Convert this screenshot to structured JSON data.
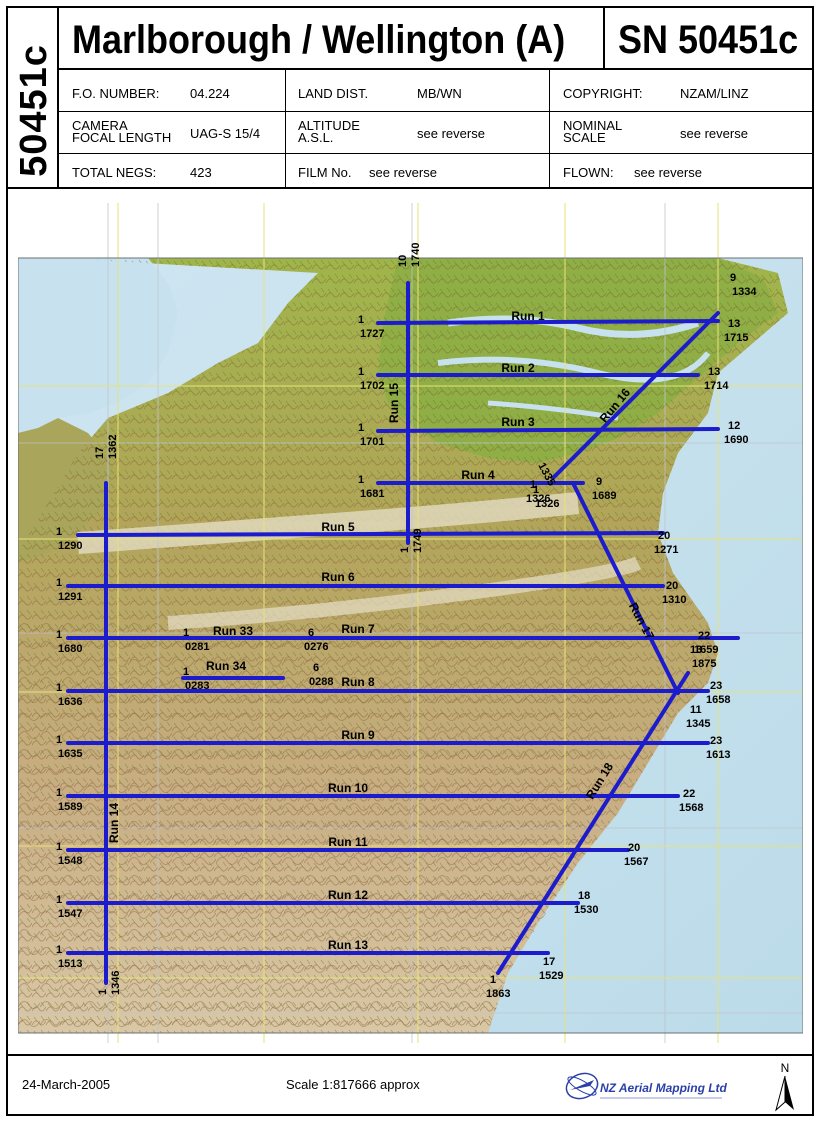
{
  "header": {
    "side_code": "50451c",
    "title": "Marlborough / Wellington (A)",
    "sn_label": "SN  50451c"
  },
  "info": {
    "fo_label": "F.O. NUMBER:",
    "fo_value": "04.224",
    "land_label": "LAND DIST.",
    "land_value": "MB/WN",
    "copyright_label": "COPYRIGHT:",
    "copyright_value": "NZAM/LINZ",
    "camera_label_1": "CAMERA",
    "camera_label_2": "FOCAL LENGTH",
    "camera_value": "UAG-S 15/4",
    "altitude_label_1": "ALTITUDE",
    "altitude_label_2": "A.S.L.",
    "altitude_value": "see reverse",
    "nominal_label_1": "NOMINAL",
    "nominal_label_2": "SCALE",
    "nominal_value": "see reverse",
    "negs_label": "TOTAL NEGS:",
    "negs_value": "423",
    "film_label": "FILM No.",
    "film_value": "see reverse",
    "flown_label": "FLOWN:",
    "flown_value": "see reverse"
  },
  "map": {
    "runs": [
      {
        "label": "Run 1",
        "start": [
          "1",
          "1727"
        ],
        "end": [
          "13",
          "1715"
        ]
      },
      {
        "label": "Run 2",
        "start": [
          "1",
          "1702"
        ],
        "end": [
          "13",
          "1714"
        ]
      },
      {
        "label": "Run 3",
        "start": [
          "1",
          "1701"
        ],
        "end": [
          "12",
          "1690"
        ]
      },
      {
        "label": "Run 4",
        "start": [
          "1",
          "1681"
        ],
        "end": [
          "9",
          "1689"
        ]
      },
      {
        "label": "Run 5",
        "start": [
          "1",
          "1290"
        ],
        "end": [
          "20",
          "1271"
        ]
      },
      {
        "label": "Run 6",
        "start": [
          "1",
          "1291"
        ],
        "end": [
          "20",
          "1310"
        ]
      },
      {
        "label": "Run 7",
        "start": [
          "1",
          "1680"
        ],
        "end": [
          "22",
          "1659"
        ]
      },
      {
        "label": "Run 8",
        "start": [
          "1",
          "1636"
        ],
        "end": [
          "23",
          "1658"
        ]
      },
      {
        "label": "Run 9",
        "start": [
          "1",
          "1635"
        ],
        "end": [
          "23",
          "1613"
        ]
      },
      {
        "label": "Run 10",
        "start": [
          "1",
          "1589"
        ],
        "end": [
          "22",
          "1568"
        ]
      },
      {
        "label": "Run 11",
        "start": [
          "1",
          "1548"
        ],
        "end": [
          "20",
          "1567"
        ]
      },
      {
        "label": "Run 12",
        "start": [
          "1",
          "1547"
        ],
        "end": [
          "18",
          "1530"
        ]
      },
      {
        "label": "Run 13",
        "start": [
          "1",
          "1513"
        ],
        "end": [
          "17",
          "1529"
        ]
      },
      {
        "label": "Run 14",
        "start": [
          "17",
          "1362"
        ],
        "end": [
          "1",
          "1346"
        ]
      },
      {
        "label": "Run 15",
        "start": [
          "10",
          "1740"
        ],
        "end": [
          "1",
          "1749"
        ]
      },
      {
        "label": "Run 16",
        "start": [
          "9",
          "1334"
        ],
        "end": [
          "1",
          "1326"
        ]
      },
      {
        "label": "Run 17",
        "start": [
          "1",
          "1326"
        ],
        "end": [
          "11",
          "1345"
        ]
      },
      {
        "label": "Run 18",
        "start": [
          "13",
          "1875"
        ],
        "end": [
          "1",
          "1863"
        ]
      },
      {
        "label": "Run 33",
        "start": [
          "1",
          "0281"
        ],
        "end": [
          "6",
          "0276"
        ]
      },
      {
        "label": "Run 34",
        "start": [
          "1",
          "0283"
        ],
        "end": [
          "6",
          "0288"
        ]
      }
    ],
    "extra_label": "1335",
    "line_color": "#1c1ccc"
  },
  "footer": {
    "date": "24-March-2005",
    "scale": "Scale  1:817666 approx",
    "company": "NZ Aerial Mapping Ltd",
    "north": "N"
  }
}
